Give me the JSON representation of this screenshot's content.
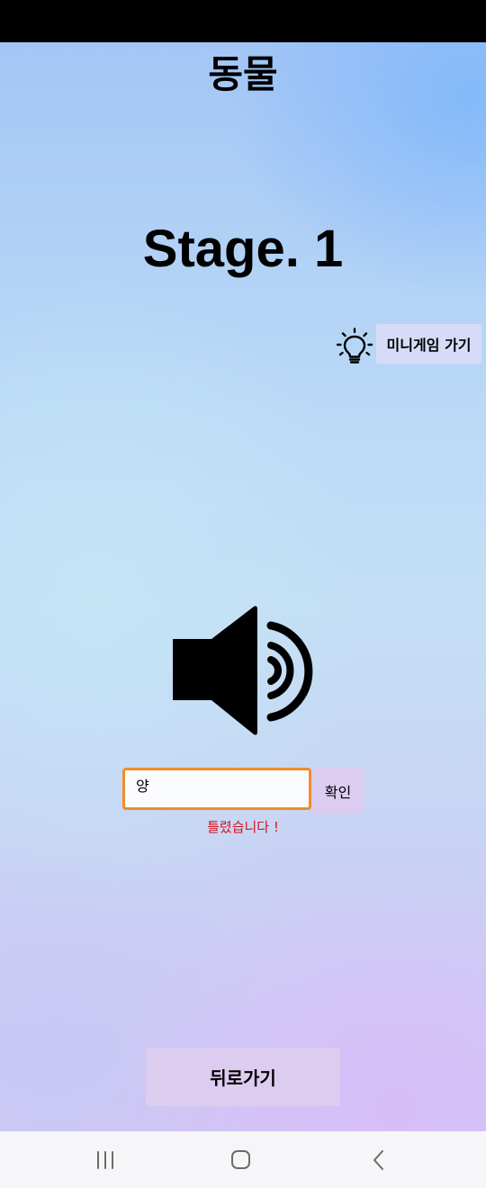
{
  "header": {
    "category_title": "동물",
    "stage_title": "Stage. 1"
  },
  "hint": {
    "icon": "lightbulb-icon",
    "minigame_label": "미니게임 가기"
  },
  "audio": {
    "icon": "speaker-icon"
  },
  "answer": {
    "value": "양",
    "confirm_label": "확인",
    "result_message": "틀렸습니다 !"
  },
  "footer": {
    "back_label": "뒤로가기"
  },
  "system_nav": {
    "recent_icon": "recent-apps-icon",
    "home_icon": "home-icon",
    "back_icon": "back-arrow-icon"
  },
  "colors": {
    "input_border": "#f08c2a",
    "error_text": "#d6141e",
    "button_bg": "#dcccf0"
  }
}
